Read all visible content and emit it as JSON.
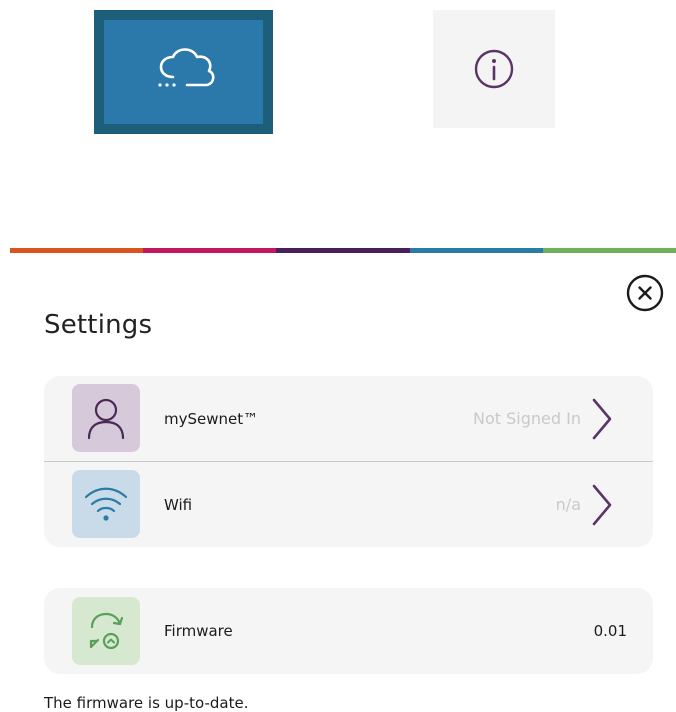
{
  "colors": {
    "cloud_button_border": "#1d5e7b",
    "cloud_button_fill": "#2b79aa",
    "info_button_bg": "#f4f4f4",
    "accent_purple": "#5b3569",
    "stripe": [
      "#d9541e",
      "#c2185b",
      "#4a1f5c",
      "#2a7ba6",
      "#6fb15b"
    ]
  },
  "toolbar": {
    "cloud_icon": "cloud-icon",
    "info_icon": "info-icon"
  },
  "dialog": {
    "close_icon": "close-icon",
    "title": "Settings"
  },
  "settings_rows": [
    {
      "icon": "person-icon",
      "label": "mySewnet™",
      "value": "Not Signed In",
      "tile_color": "#d6c9da"
    },
    {
      "icon": "wifi-icon",
      "label": "Wifi",
      "value": "n/a",
      "tile_color": "#c9dbe8"
    }
  ],
  "firmware": {
    "icon": "firmware-update-icon",
    "label": "Firmware",
    "value": "0.01",
    "tile_color": "#d7e8d0",
    "status": "The firmware is up-to-date."
  }
}
